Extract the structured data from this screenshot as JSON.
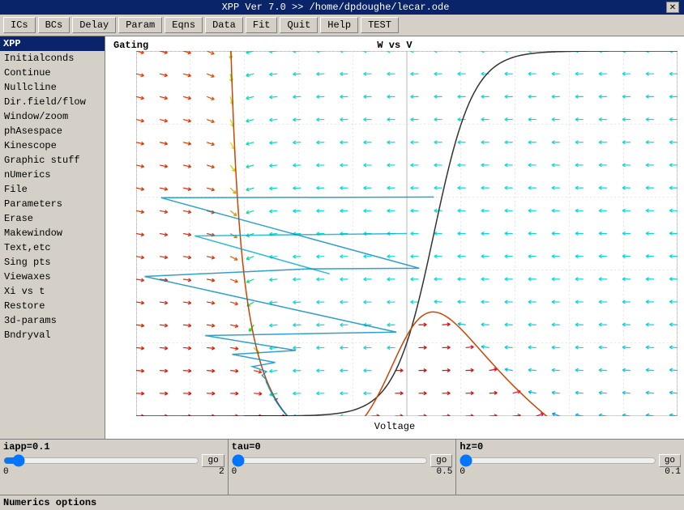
{
  "title": "XPP Ver 7.0 >> /home/dpdoughe/lecar.ode",
  "toolbar": {
    "buttons": [
      "ICs",
      "BCs",
      "Delay",
      "Param",
      "Eqns",
      "Data",
      "Fit",
      "Quit",
      "Help",
      "TEST"
    ]
  },
  "sidebar": {
    "title": "XPP",
    "items": [
      "Initialconds",
      "Continue",
      "Nullcline",
      "Dir.field/flow",
      "Window/zoom",
      "phAsespace",
      "Kinescope",
      "Graphic stuff",
      "nUmerics",
      "File",
      "Parameters",
      "Erase",
      "Makewindow",
      "Text,etc",
      "Sing pts",
      "Viewaxes",
      "Xi vs t",
      "Restore",
      "3d-params",
      "Bndryval"
    ]
  },
  "plot": {
    "title_left": "Gating",
    "title_center": "W vs V",
    "x_label": "Voltage",
    "x_axis": {
      "-1": "−1",
      "−0.8": "−0.8",
      "−0.6": "−0.6",
      "−0.4": "−0.4",
      "−0.2": "−0.2",
      "0": "0",
      "0.2": "0.2",
      "0.4": "0.4",
      "0.6": "0.6",
      "0.8": "0.8",
      "1": "1"
    },
    "y_axis": {
      "0": "0",
      "0.2": "0.2",
      "0.4": "0.4",
      "0.6": "0.6",
      "0.8": "0.8",
      "1": "1"
    }
  },
  "sliders": [
    {
      "label": "iapp=0.1",
      "min": "0",
      "max": "2",
      "value": 0.05,
      "go": "go"
    },
    {
      "label": "tau=0",
      "min": "0",
      "max": "0.5",
      "value": 0,
      "go": "go"
    },
    {
      "label": "hz=0",
      "min": "0",
      "max": "0.1",
      "value": 0,
      "go": "go"
    }
  ],
  "status": "Numerics options"
}
